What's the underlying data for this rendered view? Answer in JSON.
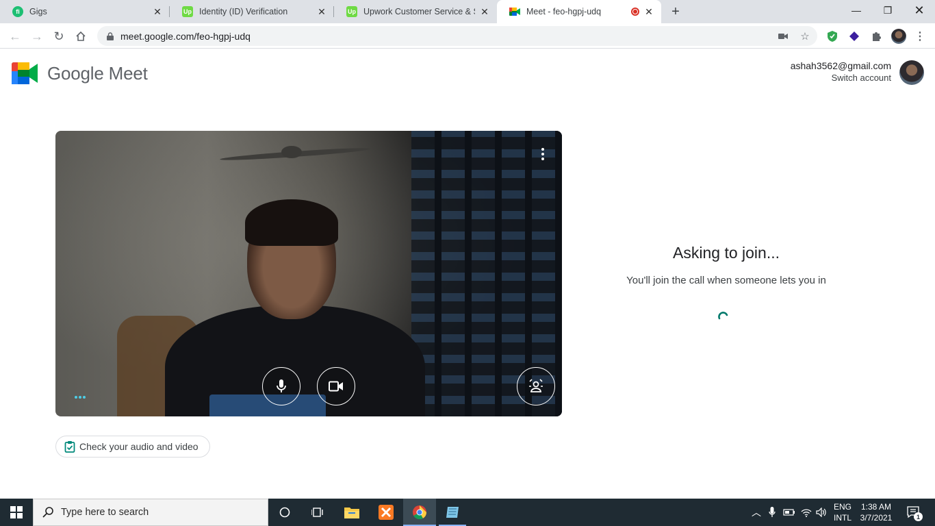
{
  "browser": {
    "tabs": [
      {
        "title": "Gigs",
        "favicon": "fiverr-icon"
      },
      {
        "title": "Identity (ID) Verification",
        "favicon": "upwork-icon"
      },
      {
        "title": "Upwork Customer Service & Sup",
        "favicon": "upwork-icon"
      },
      {
        "title": "Meet - feo-hgpj-udq",
        "favicon": "google-meet-icon",
        "active": true,
        "recording": true
      }
    ],
    "url": "meet.google.com/feo-hgpj-udq"
  },
  "meet": {
    "brand": "Google Meet",
    "account_email": "ashah3562@gmail.com",
    "switch_account": "Switch account",
    "check_av_label": "Check your audio and video",
    "join_title": "Asking to join...",
    "join_subtitle": "You'll join the call when someone lets you in"
  },
  "taskbar": {
    "search_placeholder": "Type here to search",
    "lang_top": "ENG",
    "lang_bottom": "INTL",
    "time": "1:38 AM",
    "date": "3/7/2021",
    "notification_count": "1"
  },
  "colors": {
    "meet_accent": "#00897b",
    "taskbar_bg": "#1f2b33",
    "tabstrip_bg": "#dee1e6",
    "recording_red": "#d93025"
  }
}
